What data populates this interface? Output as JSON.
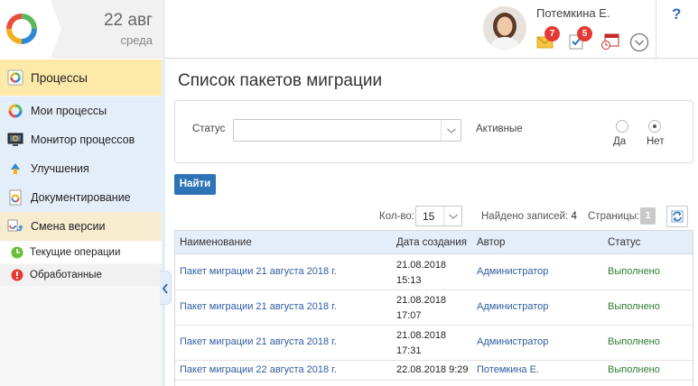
{
  "header": {
    "date_main": "22 авг",
    "date_sub": "среда",
    "user_name": "Потемкина Е.",
    "mail_badge": "7",
    "tasks_badge": "5",
    "help_label": "?"
  },
  "sidebar": {
    "top_item": "Процессы",
    "items": [
      {
        "label": "Мои процессы"
      },
      {
        "label": "Монитор процессов"
      },
      {
        "label": "Улучшения"
      },
      {
        "label": "Документирование"
      },
      {
        "label": "Смена версии"
      }
    ],
    "sub_items": [
      {
        "label": "Текущие операции"
      },
      {
        "label": "Обработанные"
      }
    ]
  },
  "main": {
    "title": "Список пакетов миграции",
    "filter": {
      "status_label": "Статус",
      "status_value": "",
      "active_label": "Активные",
      "yes_label": "Да",
      "no_label": "Нет",
      "active_selected": "Нет"
    },
    "find_button": "Найти",
    "pager": {
      "count_label": "Кол-во:",
      "count_value": "15",
      "found_label": "Найдено записей:",
      "found_value": "4",
      "pages_label": "Страницы:",
      "page_value": "1"
    },
    "table": {
      "columns": [
        "Наименование",
        "Дата создания",
        "Автор",
        "Статус"
      ],
      "rows": [
        {
          "name": "Пакет миграции 21 августа 2018 г.",
          "date": "21.08.2018",
          "time": "15:13",
          "author": "Администратор",
          "status": "Выполнено"
        },
        {
          "name": "Пакет миграции 21 августа 2018 г.",
          "date": "21.08.2018",
          "time": "17:07",
          "author": "Администратор",
          "status": "Выполнено"
        },
        {
          "name": "Пакет миграции 21 августа 2018 г.",
          "date": "21.08.2018",
          "time": "17:31",
          "author": "Администратор",
          "status": "Выполнено"
        },
        {
          "name": "Пакет миграции 22 августа 2018 г.",
          "date": "22.08.2018 9:29",
          "time": "",
          "author": "Потемкина Е.",
          "status": "Выполнено"
        }
      ]
    }
  },
  "colors": {
    "accent": "#2f73b7",
    "sidebar_active": "#fde9a8",
    "sidebar_blue": "#e4eef9",
    "status_done": "#2e7d32",
    "badge": "#e53935"
  }
}
